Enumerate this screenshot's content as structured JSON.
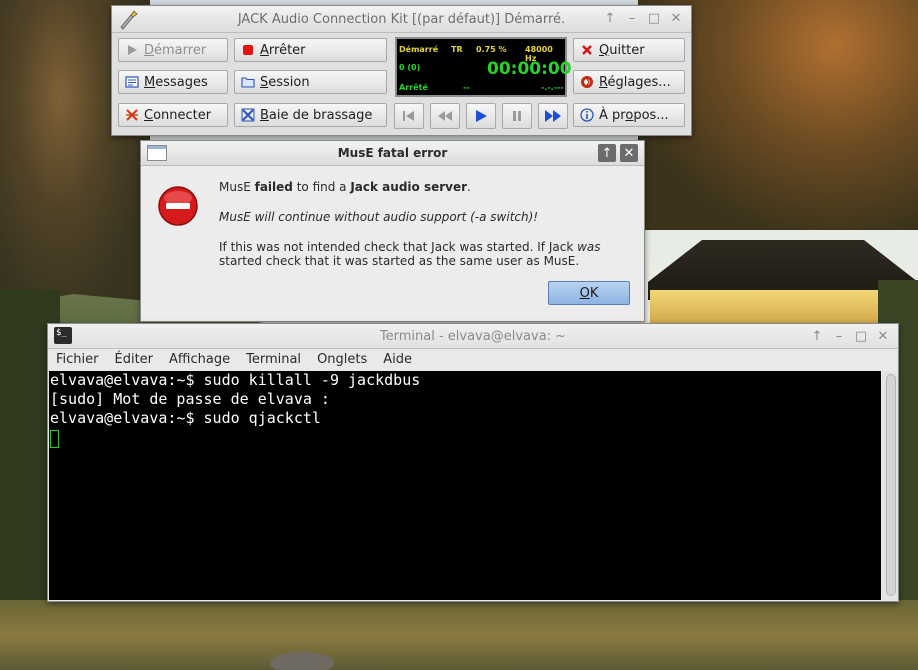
{
  "jack": {
    "title": "JACK Audio Connection Kit [(par défaut)] Démarré.",
    "buttons": {
      "start": "émarrer",
      "start_u": "D",
      "stop": "rrêter",
      "stop_u": "A",
      "quit": "uitter",
      "quit_u": "Q",
      "messages": "essages",
      "messages_u": "M",
      "session": "ession",
      "session_u": "S",
      "settings": "églages...",
      "settings_u": "R",
      "connect": "onnecter",
      "connect_u": "C",
      "patchbay": "aie de brassage",
      "patchbay_u": "B",
      "about": "À pr",
      "about_u": "o",
      "about_rest": "pos..."
    },
    "lcd": {
      "status": "Démarré",
      "tr": "TR",
      "dsp": "0.75 %",
      "rate": "48000 Hz",
      "xruns": "0 (0)",
      "time": "00:00:00",
      "transport": "Arrêté",
      "bpm": "--",
      "bbt": "-.-.---"
    },
    "colors": {
      "lcd_green": "#27d52a",
      "lcd_yellow": "#e6d52c",
      "stop_red": "#e31414",
      "play_blue": "#1c4fd8"
    }
  },
  "muse": {
    "title": "MusE fatal error",
    "line1_pre": "MusE ",
    "line1_b1": "failed",
    "line1_mid": " to find a ",
    "line1_b2": "Jack audio server",
    "line1_end": ".",
    "line2": "MusE will continue without audio support (-a switch)!",
    "line3_pre": "If this was not intended check that Jack was started. If Jack ",
    "line3_em": "was",
    "line3_post": " started check that it was started as the same user as MusE.",
    "ok_u": "O",
    "ok_rest": "K"
  },
  "terminal": {
    "title": "Terminal - elvava@elvava: ~",
    "menu": [
      "Fichier",
      "Éditer",
      "Affichage",
      "Terminal",
      "Onglets",
      "Aide"
    ],
    "lines": [
      "elvava@elvava:~$ sudo killall -9 jackdbus",
      "[sudo] Mot de passe de elvava :",
      "elvava@elvava:~$ sudo qjackctl"
    ]
  }
}
